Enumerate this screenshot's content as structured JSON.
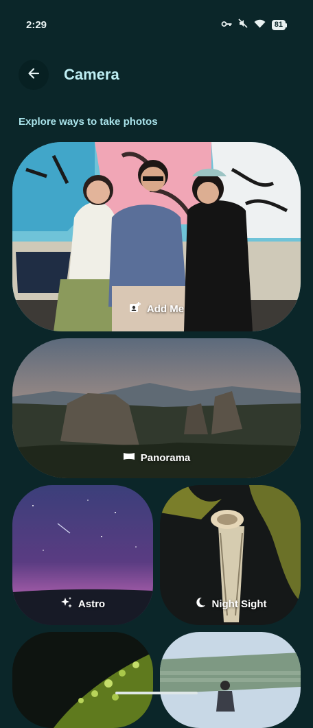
{
  "status_bar": {
    "time": "2:29",
    "battery": "81"
  },
  "header": {
    "title": "Camera"
  },
  "section": {
    "label": "Explore ways to take photos"
  },
  "cards": [
    {
      "label": "Add Me",
      "icon": "add-me-icon"
    },
    {
      "label": "Panorama",
      "icon": "panorama-icon"
    },
    {
      "label": "Astro",
      "icon": "sparkle-icon"
    },
    {
      "label": "Night Sight",
      "icon": "moon-icon"
    }
  ]
}
